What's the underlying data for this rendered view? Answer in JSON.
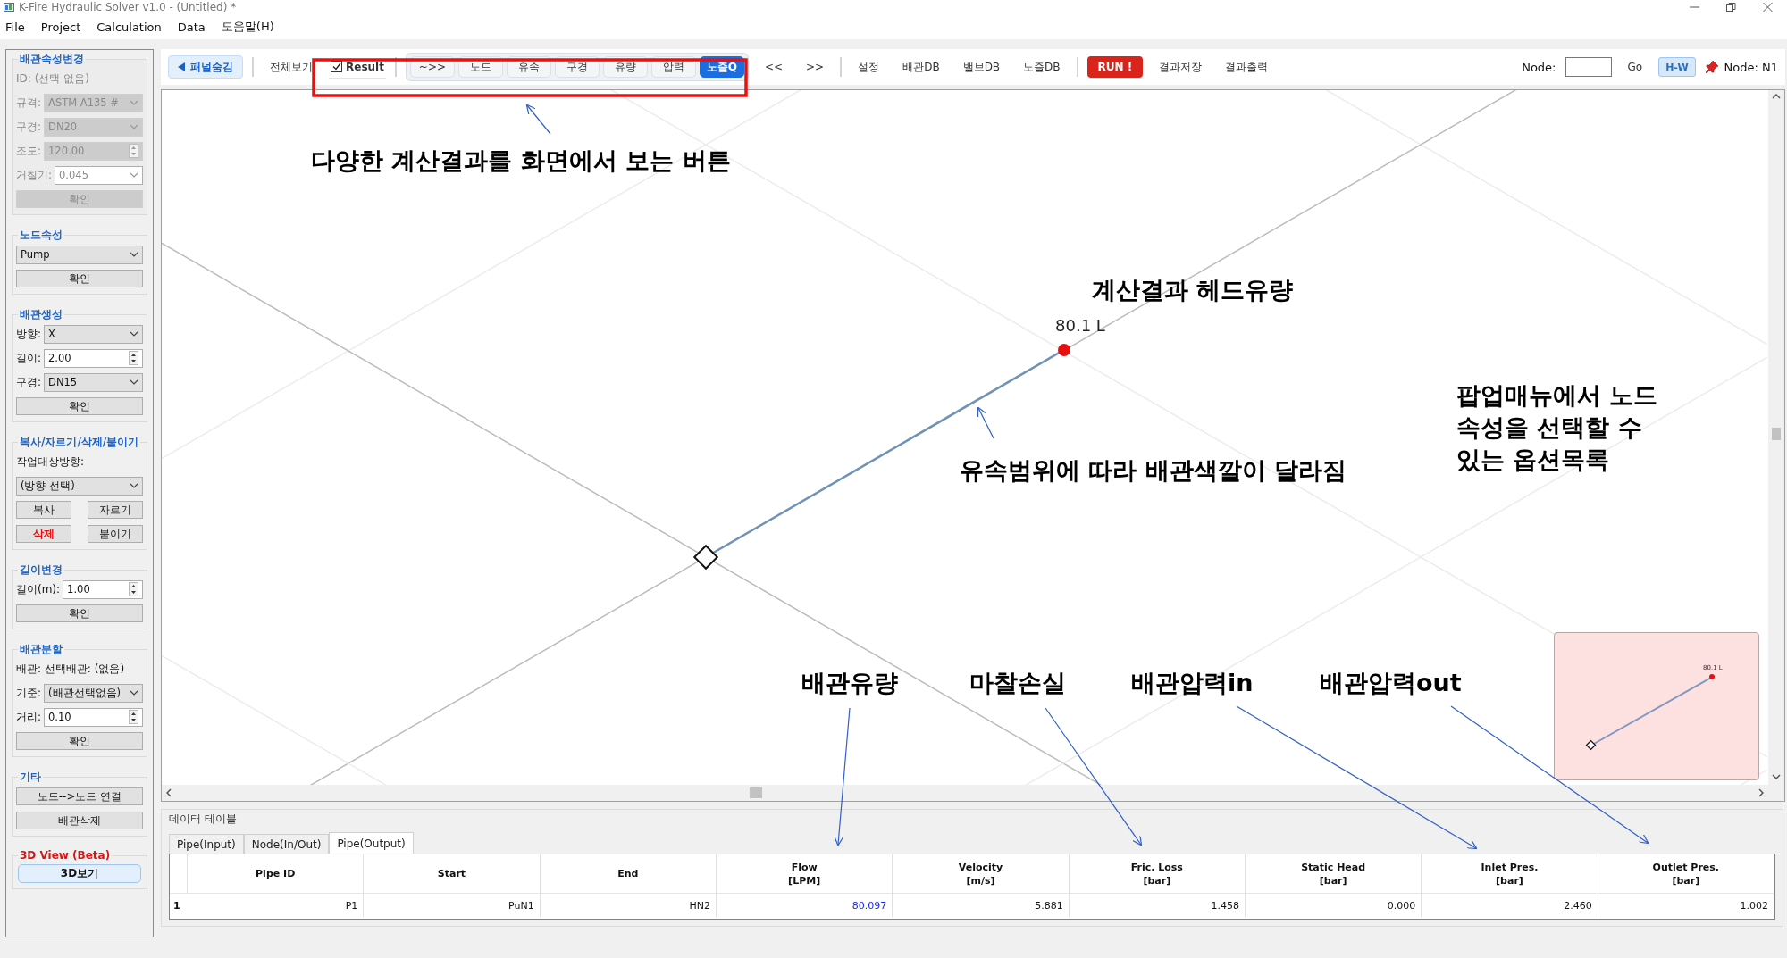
{
  "window": {
    "title": "K-Fire Hydraulic Solver v1.0 - (Untitled) *"
  },
  "menu": [
    "File",
    "Project",
    "Calculation",
    "Data",
    "도움말(H)"
  ],
  "panel": {
    "groups": [
      {
        "title": "배관속성변경",
        "color": "#1c64c8",
        "disabled": true,
        "rows": [
          {
            "kind": "text",
            "text": "ID: (선택 없음)"
          },
          {
            "kind": "select",
            "label": "규격:",
            "value": "ASTM A135 #"
          },
          {
            "kind": "select",
            "label": "구경:",
            "value": "DN20"
          },
          {
            "kind": "spin",
            "label": "조도:",
            "value": "120.00"
          },
          {
            "kind": "combo",
            "label": "거칠기:",
            "value": "0.045"
          },
          {
            "kind": "buttons",
            "buttons": [
              {
                "label": "확인",
                "kind": "normal"
              }
            ]
          }
        ]
      },
      {
        "title": "노드속성",
        "color": "#1c64c8",
        "disabled": false,
        "rows": [
          {
            "kind": "select",
            "value": "Pump"
          },
          {
            "kind": "buttons",
            "buttons": [
              {
                "label": "확인",
                "kind": "normal"
              }
            ]
          }
        ]
      },
      {
        "title": "배관생성",
        "color": "#1c64c8",
        "disabled": false,
        "rows": [
          {
            "kind": "select",
            "label": "방향:",
            "value": "X"
          },
          {
            "kind": "spin",
            "label": "길이:",
            "value": "2.00"
          },
          {
            "kind": "select",
            "label": "구경:",
            "value": "DN15"
          },
          {
            "kind": "buttons",
            "buttons": [
              {
                "label": "확인",
                "kind": "normal"
              }
            ]
          }
        ]
      },
      {
        "title": "복사/자르기/삭제/붙이기",
        "color": "#1c64c8",
        "disabled": false,
        "rows": [
          {
            "kind": "text",
            "text": "작업대상방향:"
          },
          {
            "kind": "select",
            "value": "(방향 선택)"
          },
          {
            "kind": "buttons",
            "buttons": [
              {
                "label": "복사",
                "kind": "normal"
              },
              {
                "label": "자르기",
                "kind": "normal"
              }
            ]
          },
          {
            "kind": "buttons",
            "buttons": [
              {
                "label": "삭제",
                "kind": "danger"
              },
              {
                "label": "붙이기",
                "kind": "normal"
              }
            ]
          }
        ]
      },
      {
        "title": "길이변경",
        "color": "#1c64c8",
        "disabled": false,
        "rows": [
          {
            "kind": "spin",
            "label": "길이(m):",
            "value": "1.00"
          },
          {
            "kind": "buttons",
            "buttons": [
              {
                "label": "확인",
                "kind": "normal"
              }
            ]
          }
        ]
      },
      {
        "title": "배관분할",
        "color": "#1c64c8",
        "disabled": false,
        "rows": [
          {
            "kind": "text",
            "text": "배관: 선택배관: (없음)"
          },
          {
            "kind": "select",
            "label": "기준:",
            "value": "(배관선택없음)"
          },
          {
            "kind": "spin",
            "label": "거리:",
            "value": "0.10"
          },
          {
            "kind": "buttons",
            "buttons": [
              {
                "label": "확인",
                "kind": "normal"
              }
            ]
          }
        ]
      },
      {
        "title": "기타",
        "color": "#1c64c8",
        "disabled": false,
        "rows": [
          {
            "kind": "buttons",
            "buttons": [
              {
                "label": "노드-->노드 연결",
                "kind": "normal"
              }
            ]
          },
          {
            "kind": "buttons",
            "buttons": [
              {
                "label": "배관삭제",
                "kind": "normal"
              }
            ]
          }
        ]
      },
      {
        "title": "3D View (Beta)",
        "color": "#d01818",
        "disabled": false,
        "rows": [
          {
            "kind": "buttons",
            "buttons": [
              {
                "label": "3D보기",
                "kind": "primary"
              }
            ]
          }
        ]
      }
    ]
  },
  "toolbar": {
    "left": [
      {
        "kind": "soft",
        "label": "패널숨김"
      },
      {
        "kind": "separator"
      },
      {
        "kind": "plain",
        "label": "전체보기"
      },
      {
        "kind": "checkbox",
        "label": "Result",
        "checked": true
      },
      {
        "kind": "separator"
      },
      {
        "kind": "segmented",
        "buttons": [
          {
            "label": "~>>",
            "selected": false
          },
          {
            "label": "노드",
            "selected": false
          },
          {
            "label": "유속",
            "selected": false
          },
          {
            "label": "구경",
            "selected": false
          },
          {
            "label": "유량",
            "selected": false
          },
          {
            "label": "압력",
            "selected": false
          },
          {
            "label": "노즐Q",
            "selected": true
          }
        ]
      },
      {
        "kind": "plain",
        "label": "<<"
      },
      {
        "kind": "plain",
        "label": ">>"
      },
      {
        "kind": "separator"
      },
      {
        "kind": "plain",
        "label": "설정"
      },
      {
        "kind": "plain",
        "label": "배관DB"
      },
      {
        "kind": "plain",
        "label": "밸브DB"
      },
      {
        "kind": "plain",
        "label": "노즐DB"
      },
      {
        "kind": "separator"
      },
      {
        "kind": "danger",
        "label": "RUN !"
      },
      {
        "kind": "plain",
        "label": "결과저장"
      },
      {
        "kind": "plain",
        "label": "결과출력"
      }
    ],
    "right": [
      {
        "kind": "field",
        "label": "Node:"
      },
      {
        "kind": "plain",
        "label": "Go"
      },
      {
        "kind": "toggle",
        "label": "H-W",
        "on": true
      },
      {
        "kind": "pin",
        "label": "Node: N1"
      }
    ]
  },
  "canvas": {
    "flow_label": "80.1 L",
    "minimap": {
      "flow_label": "80.1 L"
    }
  },
  "data_table": {
    "title": "데이터 테이블",
    "tabs": [
      {
        "label": "Pipe(Input)",
        "selected": false
      },
      {
        "label": "Node(In/Out)",
        "selected": false
      },
      {
        "label": "Pipe(Output)",
        "selected": true
      }
    ],
    "columns": [
      {
        "name": "Pipe ID"
      },
      {
        "name": "Start"
      },
      {
        "name": "End"
      },
      {
        "name": "Flow",
        "unit": "[LPM]"
      },
      {
        "name": "Velocity",
        "unit": "[m/s]"
      },
      {
        "name": "Fric. Loss",
        "unit": "[bar]"
      },
      {
        "name": "Static Head",
        "unit": "[bar]"
      },
      {
        "name": "Inlet Pres.",
        "unit": "[bar]"
      },
      {
        "name": "Outlet Pres.",
        "unit": "[bar]"
      }
    ],
    "rows": [
      {
        "index": "1",
        "cells": [
          {
            "text": "P1",
            "highlighted": false
          },
          {
            "text": "PuN1",
            "highlighted": false
          },
          {
            "text": "HN2",
            "highlighted": false
          },
          {
            "text": "80.097",
            "highlighted": true
          },
          {
            "text": "5.881",
            "highlighted": false
          },
          {
            "text": "1.458",
            "highlighted": false
          },
          {
            "text": "0.000",
            "highlighted": false
          },
          {
            "text": "2.460",
            "highlighted": false
          },
          {
            "text": "1.002",
            "highlighted": false
          }
        ]
      }
    ]
  },
  "annotations": [
    {
      "lines": [
        "다양한 계산결과를 화면에서 보는 버튼"
      ]
    },
    {
      "lines": [
        "계산결과 헤드유량"
      ]
    },
    {
      "lines": [
        "유속범위에 따라 배관색깔이 달라짐"
      ]
    },
    {
      "lines": [
        "팝업매뉴에서 노드",
        "속성을 선택할 수",
        "있는 옵션목록"
      ]
    },
    {
      "lines": [
        "배관유량"
      ]
    },
    {
      "lines": [
        "마찰손실"
      ]
    },
    {
      "lines": [
        "배관압력in"
      ]
    },
    {
      "lines": [
        "배관압력out"
      ]
    }
  ]
}
